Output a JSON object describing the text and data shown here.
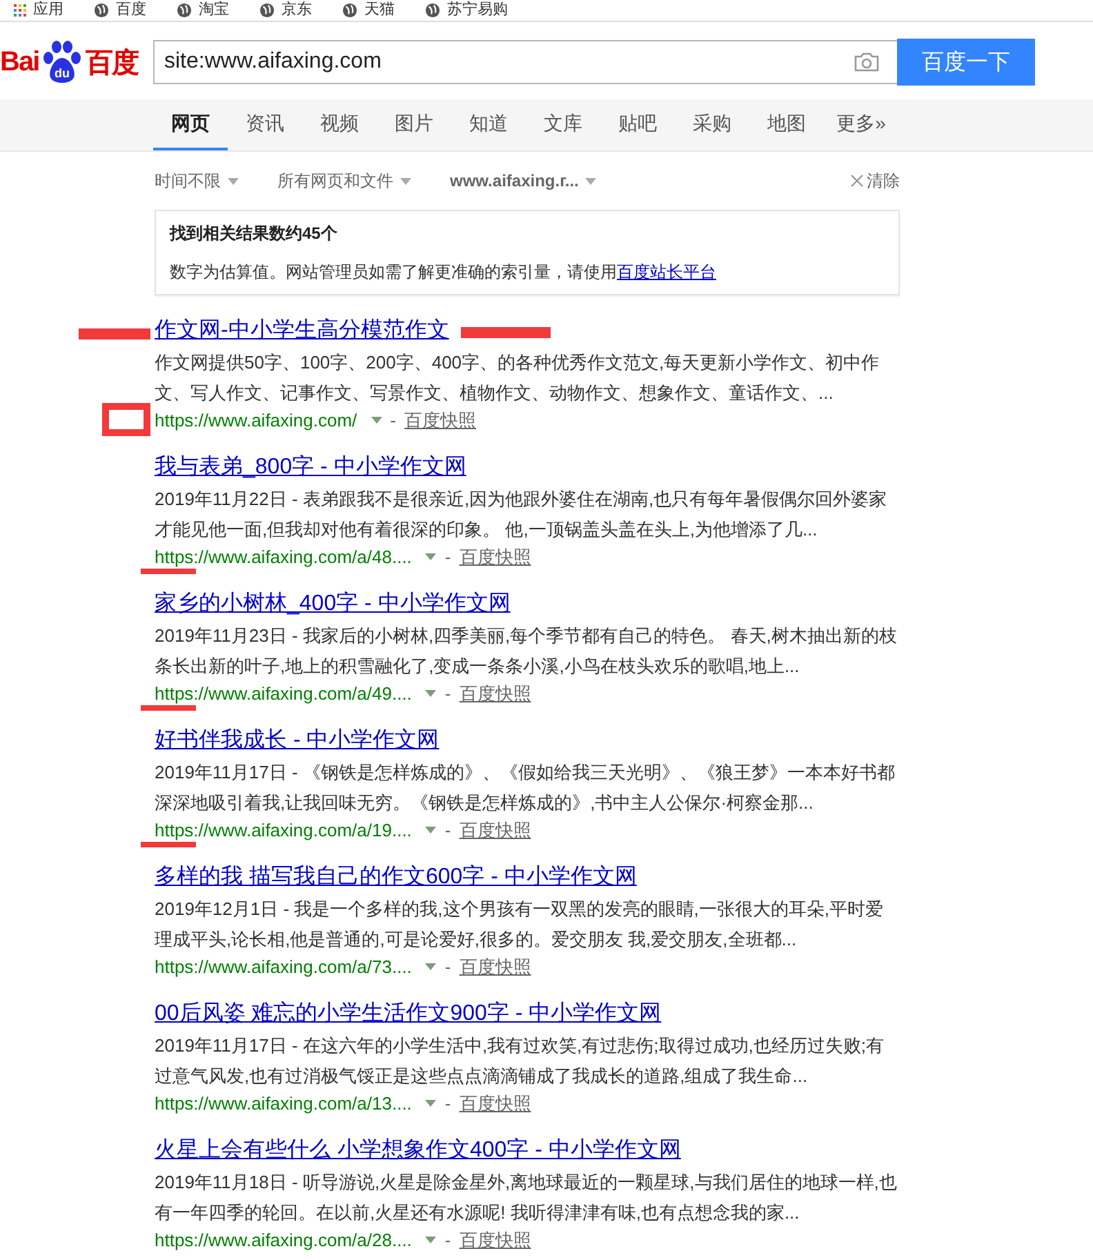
{
  "bookmarks": [
    {
      "label": "应用",
      "kind": "apps"
    },
    {
      "label": "百度",
      "kind": "site"
    },
    {
      "label": "淘宝",
      "kind": "site"
    },
    {
      "label": "京东",
      "kind": "site"
    },
    {
      "label": "天猫",
      "kind": "site"
    },
    {
      "label": "苏宁易购",
      "kind": "site"
    }
  ],
  "logo": {
    "part_1": "Bai",
    "part_2": "du",
    "part_3": "百度"
  },
  "search": {
    "value": "site:www.aifaxing.com",
    "button": "百度一下"
  },
  "tabs": [
    {
      "label": "网页",
      "selected": true
    },
    {
      "label": "资讯",
      "selected": false
    },
    {
      "label": "视频",
      "selected": false
    },
    {
      "label": "图片",
      "selected": false
    },
    {
      "label": "知道",
      "selected": false
    },
    {
      "label": "文库",
      "selected": false
    },
    {
      "label": "贴吧",
      "selected": false
    },
    {
      "label": "采购",
      "selected": false
    },
    {
      "label": "地图",
      "selected": false
    },
    {
      "label": "更多»",
      "selected": false
    }
  ],
  "filters": [
    {
      "label": "时间不限",
      "bold": false
    },
    {
      "label": "所有网页和文件",
      "bold": false
    },
    {
      "label": "www.aifaxing.г...",
      "bold": true
    }
  ],
  "clear": "清除",
  "info": {
    "title": "找到相关结果数约45个",
    "text": "数字为估算值。网站管理员如需了解更准确的索引量，请使用",
    "link": "百度站长平台"
  },
  "results": [
    {
      "title": "作文网-中小学生高分模范作文",
      "snippet": "作文网提供50字、100字、200字、400字、的各种优秀作文范文,每天更新小学作文、初中作文、写人作文、记事作文、写景作文、植物作文、动物作文、想象作文、童话作文、...",
      "url": "https://www.aifaxing.com/",
      "separator": "-",
      "cache": "百度快照",
      "title_annotated": true,
      "url_annotated": false
    },
    {
      "title": "我与表弟_800字 - 中小学作文网",
      "date": "2019年11月22日 -",
      "snippet": "表弟跟我不是很亲近,因为他跟外婆住在湖南,也只有每年暑假偶尔回外婆家才能见他一面,但我却对他有着很深的印象。 他,一顶锅盖头盖在头上,为他增添了几...",
      "url": "https://www.aifaxing.com/a/48....",
      "separator": "-",
      "cache": "百度快照",
      "title_annotated": false,
      "url_annotated": true
    },
    {
      "title": "家乡的小树林_400字 - 中小学作文网",
      "date": "2019年11月23日 -",
      "snippet": "我家后的小树林,四季美丽,每个季节都有自己的特色。 春天,树木抽出新的枝条长出新的叶子,地上的积雪融化了,变成一条条小溪,小鸟在枝头欢乐的歌唱,地上...",
      "url": "https://www.aifaxing.com/a/49....",
      "separator": "-",
      "cache": "百度快照",
      "title_annotated": false,
      "url_annotated": true
    },
    {
      "title": "好书伴我成长 - 中小学作文网",
      "date": "2019年11月17日 -",
      "snippet": "《钢铁是怎样炼成的》、《假如给我三天光明》、《狼王梦》一本本好书都深深地吸引着我,让我回味无穷。《钢铁是怎样炼成的》,书中主人公保尔·柯察金那...",
      "url": "https://www.aifaxing.com/a/19....",
      "separator": "-",
      "cache": "百度快照",
      "title_annotated": false,
      "url_annotated": true
    },
    {
      "title": "多样的我 描写我自己的作文600字 - 中小学作文网",
      "date": "2019年12月1日 -",
      "snippet": "我是一个多样的我,这个男孩有一双黑的发亮的眼睛,一张很大的耳朵,平时爱理成平头,论长相,他是普通的,可是论爱好,很多的。爱交朋友 我,爱交朋友,全班都...",
      "url": "https://www.aifaxing.com/a/73....",
      "separator": "-",
      "cache": "百度快照",
      "title_annotated": false,
      "url_annotated": false
    },
    {
      "title": "00后风姿 难忘的小学生活作文900字 - 中小学作文网",
      "date": "2019年11月17日 -",
      "snippet": "在这六年的小学生活中,我有过欢笑,有过悲伤;取得过成功,也经历过失败;有过意气风发,也有过消极气馁正是这些点点滴滴铺成了我成长的道路,组成了我生命...",
      "url": "https://www.aifaxing.com/a/13....",
      "separator": "-",
      "cache": "百度快照",
      "title_annotated": false,
      "url_annotated": false
    },
    {
      "title": "火星上会有些什么 小学想象作文400字 - 中小学作文网",
      "date": "2019年11月18日 -",
      "snippet": "听导游说,火星是除金星外,离地球最近的一颗星球,与我们居住的地球一样,也有一年四季的轮回。在以前,火星还有水源呢! 我听得津津有味,也有点想念我的家...",
      "url": "https://www.aifaxing.com/a/28....",
      "separator": "-",
      "cache": "百度快照",
      "title_annotated": false,
      "url_annotated": false
    }
  ]
}
